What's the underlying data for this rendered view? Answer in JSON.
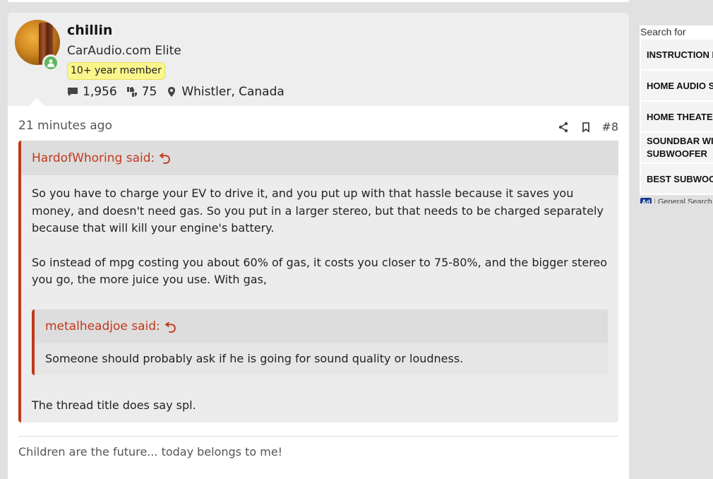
{
  "user": {
    "name": "chillin",
    "title": "CarAudio.com Elite",
    "banner": "10+ year member",
    "messages": "1,956",
    "reactions": "75",
    "location": "Whistler, Canada"
  },
  "post": {
    "time": "21 minutes ago",
    "number": "#8",
    "outer_quote": {
      "author": "HardofWhoring said:",
      "paragraphs": [
        "So you have to charge your EV to drive it, and you put up with that hassle because it saves you money, and doesn't need gas. So you put in a larger stereo, but that needs to be charged separately because that will kill your engine's battery.",
        "So instead of mpg costing you about 60% of gas, it costs you closer to 75-80%, and the bigger stereo you go, the more juice you use. With gas,"
      ],
      "inner_quote": {
        "author": "metalheadjoe said:",
        "text": "Someone should probably ask if he is going for sound quality or loudness."
      },
      "reply": "The thread title does say spl."
    },
    "signature": "Children are the future... today belongs to me!"
  },
  "sidebar_ad": {
    "search_label": "Search for",
    "items": [
      {
        "label": "INSTRUCTION MANUALS"
      },
      {
        "label": "HOME AUDIO SPEAKERS"
      },
      {
        "label": "HOME THEATER SYSTEMS"
      },
      {
        "label": "SOUNDBAR WITH SUBWOOFER"
      },
      {
        "label": "BEST SUBWOOFER"
      }
    ],
    "ad_badge": "Ad",
    "footer": "General Search"
  },
  "colors": {
    "quote_accent": "#c0391b",
    "online": "#5cb85c",
    "banner_yellow": "#fbf68c"
  }
}
